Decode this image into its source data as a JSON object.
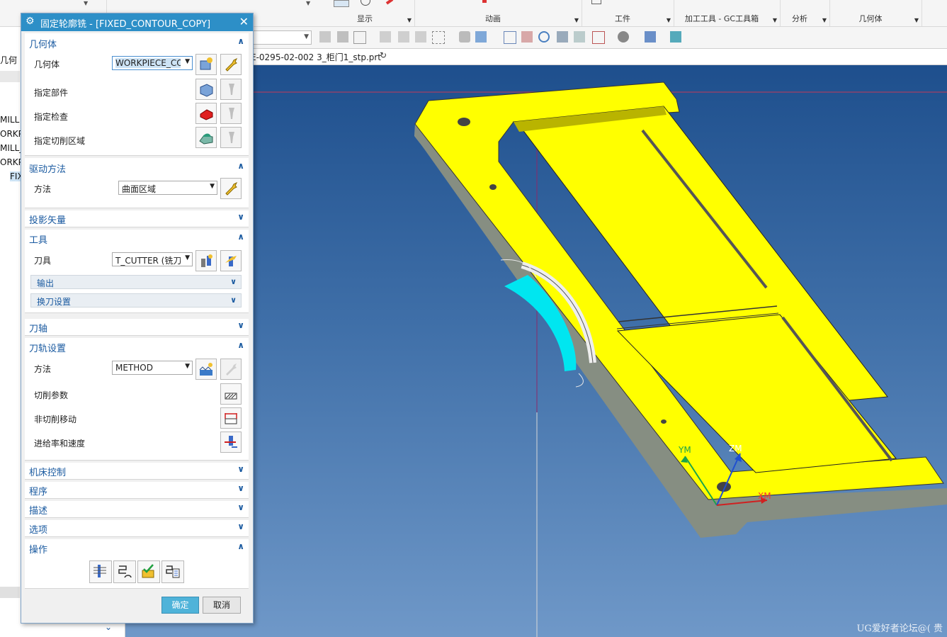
{
  "ribbon": {
    "groups": [
      {
        "label": "显示"
      },
      {
        "label": "动画"
      },
      {
        "label": "工件"
      },
      {
        "label": "加工工具 - GC工具箱"
      },
      {
        "label": "分析"
      },
      {
        "label": "几何体"
      }
    ]
  },
  "file_tab": {
    "name": "E-0295-02-002 3_柜门1_stp.prt"
  },
  "navigator": {
    "header": "几何",
    "rows": [
      "MILL",
      "ORKPI",
      "MILL_",
      "ORKPI",
      "FIX"
    ]
  },
  "dialog": {
    "title": "固定轮廓铣 - [FIXED_CONTOUR_COPY]",
    "geometry": {
      "header": "几何体",
      "geometry_label": "几何体",
      "geometry_value": "WORKPIECE_CO",
      "specify_part": "指定部件",
      "specify_check": "指定检查",
      "specify_cut_area": "指定切削区域"
    },
    "drive": {
      "header": "驱动方法",
      "method_label": "方法",
      "method_value": "曲面区域"
    },
    "projection": {
      "header": "投影矢量"
    },
    "tool": {
      "header": "工具",
      "tool_label": "刀具",
      "tool_value": "T_CUTTER (铣刀-",
      "output": "输出",
      "tool_change": "换刀设置"
    },
    "tool_axis": {
      "header": "刀轴"
    },
    "path_settings": {
      "header": "刀轨设置",
      "method_label": "方法",
      "method_value": "METHOD",
      "cut_params": "切削参数",
      "non_cut_moves": "非切削移动",
      "feeds_speeds": "进给率和速度"
    },
    "machine_control": {
      "header": "机床控制"
    },
    "program": {
      "header": "程序"
    },
    "description": {
      "header": "描述"
    },
    "options": {
      "header": "选项"
    },
    "actions": {
      "header": "操作"
    },
    "ok": "确定",
    "cancel": "取消"
  },
  "viewport": {
    "axes": {
      "ym": "YM",
      "zm": "ZM",
      "xm": "XM"
    },
    "watermark": "UG爱好者论坛@( 贵"
  },
  "colors": {
    "title_bar": "#2d8fc7",
    "section_header": "#1a5aa0",
    "part_face": "#ffff00",
    "part_side": "#8c9488",
    "toolpath": "#00e6f0",
    "ok_button": "#4fb3d9"
  }
}
